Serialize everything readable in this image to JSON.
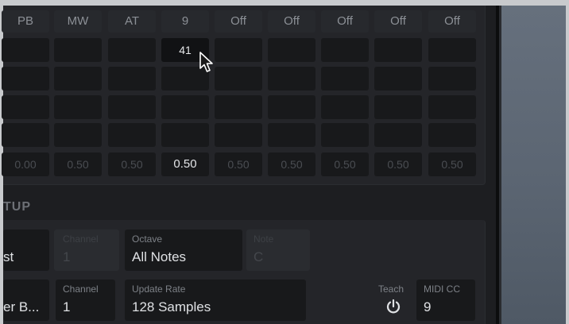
{
  "matrix": {
    "headers": [
      "PB",
      "MW",
      "AT",
      "9",
      "Off",
      "Off",
      "Off",
      "Off",
      "Off"
    ],
    "edit_value": "41",
    "values": [
      "0.00",
      "0.50",
      "0.50",
      "0.50",
      "0.50",
      "0.50",
      "0.50",
      "0.50",
      "0.50"
    ]
  },
  "setup": {
    "title": "TUP",
    "row1": {
      "partial_value": "st",
      "channel_label": "Channel",
      "channel_value": "1",
      "octave_label": "Octave",
      "octave_value": "All Notes",
      "note_label": "Note",
      "note_value": "C"
    },
    "row2": {
      "partial_value": "er B...",
      "channel_label": "Channel",
      "channel_value": "1",
      "update_rate_label": "Update Rate",
      "update_rate_value": "128 Samples",
      "teach_label": "Teach",
      "midi_cc_label": "MIDI CC",
      "midi_cc_value": "9"
    }
  },
  "icons": {
    "cursor": "mouse-pointer-icon",
    "teach": "power-icon"
  },
  "colors": {
    "background": "#1d1e21",
    "cell": "#18191b",
    "header": "#27292d",
    "sidebar": "#5b6572"
  }
}
